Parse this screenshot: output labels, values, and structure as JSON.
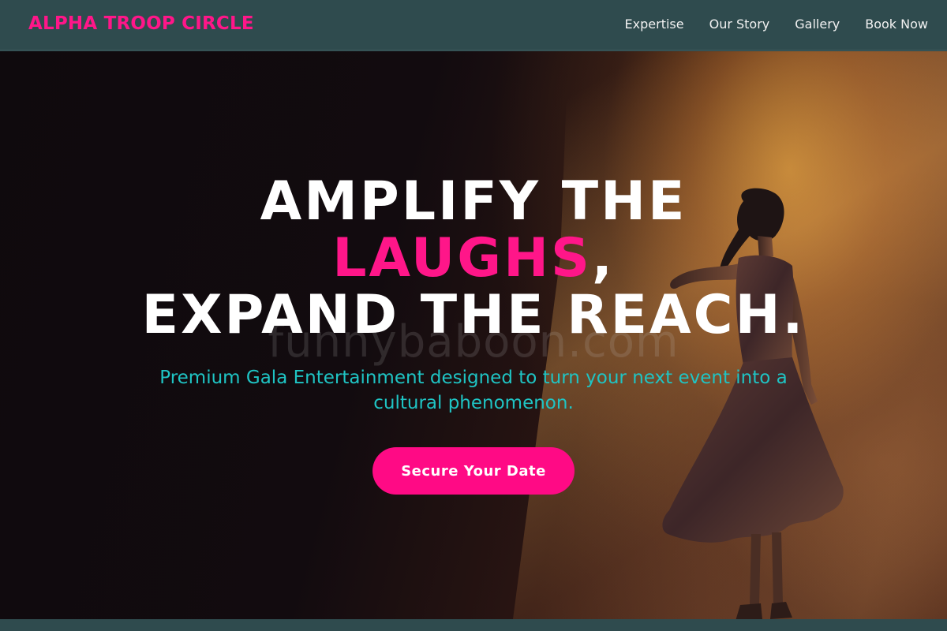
{
  "brand": {
    "name": "ALPHA TROOP CIRCLE",
    "color": "#ff1689"
  },
  "nav": {
    "items": [
      {
        "label": "Expertise"
      },
      {
        "label": "Our Story"
      },
      {
        "label": "Gallery"
      },
      {
        "label": "Book Now"
      }
    ]
  },
  "hero": {
    "title_line1": "AMPLIFY THE",
    "title_accent": "LAUGHS",
    "title_comma": ",",
    "title_line3": "EXPAND THE REACH.",
    "watermark": "funnybaboon.com",
    "subtitle": "Premium Gala Entertainment designed to turn your next event into a cultural phenomenon.",
    "cta_label": "Secure Your Date",
    "background_image": "stage-dancer-photo"
  },
  "colors": {
    "accent": "#ff1689",
    "cta": "#ff0a85",
    "subtitle": "#1fc4c4",
    "navbar": "#2f4b4e"
  }
}
